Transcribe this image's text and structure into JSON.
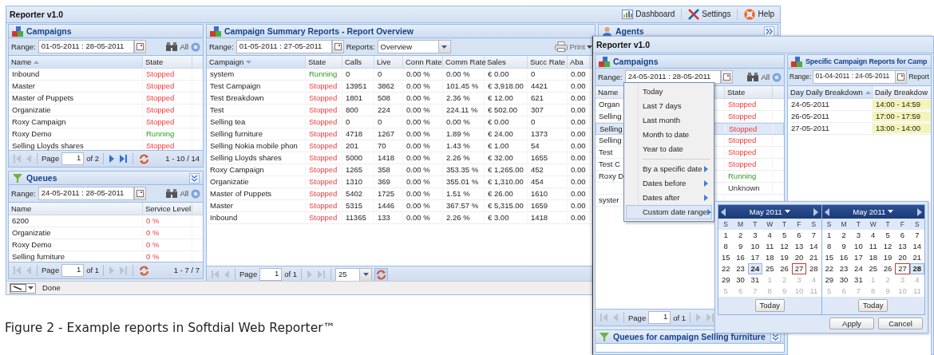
{
  "main_window": {
    "title": "Reporter v1.0",
    "toolbar": [
      {
        "label": "Dashboard"
      },
      {
        "label": "Settings"
      },
      {
        "label": "Help"
      }
    ],
    "campaigns": {
      "title": "Campaigns",
      "range_label": "Range:",
      "range": "01-05-2011 : 28-05-2011",
      "all_label": "All",
      "columns": [
        {
          "label": "Name",
          "sorted": true,
          "descending": false
        },
        {
          "label": "State",
          "sorted": false
        }
      ],
      "rows": [
        {
          "cells": [
            "Inbound",
            "Stopped"
          ],
          "kind": "stopped"
        },
        {
          "cells": [
            "Master",
            "Stopped"
          ],
          "kind": "stopped"
        },
        {
          "cells": [
            "Master of Puppets",
            "Stopped"
          ],
          "kind": "stopped"
        },
        {
          "cells": [
            "Organizatie",
            "Stopped"
          ],
          "kind": "stopped"
        },
        {
          "cells": [
            "Roxy Campaign",
            "Stopped"
          ],
          "kind": "stopped"
        },
        {
          "cells": [
            "Roxy Demo",
            "Running"
          ],
          "kind": "running"
        },
        {
          "cells": [
            "Selling Lloyds shares",
            "Stopped"
          ],
          "kind": "stopped"
        }
      ],
      "pager": {
        "label": "Page",
        "value": "1",
        "of": "of 2",
        "info": "1 - 10 / 14",
        "can_back": false,
        "can_forward": true
      }
    },
    "queues": {
      "title": "Queues",
      "range_label": "Range:",
      "range": "24-05-2011 : 28-05-2011",
      "all_label": "All",
      "columns": [
        {
          "label": "Name",
          "sorted": false
        },
        {
          "label": "Service Level",
          "sorted": false
        }
      ],
      "rows": [
        {
          "cells": [
            "6200",
            "0 %"
          ],
          "kind": "alert"
        },
        {
          "cells": [
            "Organizatie",
            "0 %"
          ],
          "kind": "alert"
        },
        {
          "cells": [
            "Roxy Demo",
            "0 %"
          ],
          "kind": "alert"
        },
        {
          "cells": [
            "Selling furniture",
            "0 %"
          ],
          "kind": "alert"
        }
      ],
      "pager": {
        "label": "Page",
        "value": "1",
        "of": "of 1",
        "info": "1 - 7 / 7",
        "can_back": false,
        "can_forward": false
      }
    },
    "summary": {
      "title": "Campaign Summary Reports - Report Overview",
      "range_label": "Range:",
      "range": "01-05-2011 : 27-05-2011",
      "reports_label": "Reports:",
      "report": "Overview",
      "print_label": "Print",
      "columns": [
        {
          "label": "Campaign",
          "sorted": true,
          "descending": true
        },
        {
          "label": "State",
          "sorted": false
        },
        {
          "label": "Calls",
          "sorted": false
        },
        {
          "label": "Live",
          "sorted": false
        },
        {
          "label": "Conn Rate",
          "sorted": false
        },
        {
          "label": "Comm Rate",
          "sorted": false
        },
        {
          "label": "Sales",
          "sorted": false
        },
        {
          "label": "Succ Rate",
          "sorted": false
        },
        {
          "label": "Aba",
          "sorted": false
        }
      ],
      "rows": [
        {
          "cells": [
            "system",
            "Running",
            "0",
            "0",
            "0.00 %",
            "0.00 %",
            "€ 0.00",
            "0",
            "0.00"
          ],
          "kind": "running"
        },
        {
          "cells": [
            "Test Campaign",
            "Stopped",
            "13951",
            "3862",
            "0.00 %",
            "101.45 %",
            "€ 3,918.00",
            "4421",
            "0.00"
          ],
          "kind": "stopped"
        },
        {
          "cells": [
            "Test Breakdown",
            "Stopped",
            "1801",
            "508",
            "0.00 %",
            "2.36 %",
            "€ 12.00",
            "621",
            "0.00"
          ],
          "kind": "stopped"
        },
        {
          "cells": [
            "Test",
            "Stopped",
            "800",
            "224",
            "0.00 %",
            "224.11 %",
            "€ 502.00",
            "307",
            "0.00"
          ],
          "kind": "stopped"
        },
        {
          "cells": [
            "Selling tea",
            "Stopped",
            "0",
            "0",
            "0.00 %",
            "0.00 %",
            "€ 0.00",
            "0",
            "0.00"
          ],
          "kind": "stopped"
        },
        {
          "cells": [
            "Selling furniture",
            "Stopped",
            "4718",
            "1267",
            "0.00 %",
            "1.89 %",
            "€ 24.00",
            "1373",
            "0.00"
          ],
          "kind": "stopped"
        },
        {
          "cells": [
            "Selling Nokia mobile phon",
            "Stopped",
            "201",
            "70",
            "0.00 %",
            "1.43 %",
            "€ 1.00",
            "54",
            "0.00"
          ],
          "kind": "stopped"
        },
        {
          "cells": [
            "Selling Lloyds shares",
            "Stopped",
            "5000",
            "1418",
            "0.00 %",
            "2.26 %",
            "€ 32.00",
            "1655",
            "0.00"
          ],
          "kind": "stopped"
        },
        {
          "cells": [
            "Roxy Campaign",
            "Stopped",
            "1265",
            "358",
            "0.00 %",
            "353.35 %",
            "€ 1,265.00",
            "452",
            "0.00"
          ],
          "kind": "stopped"
        },
        {
          "cells": [
            "Organizatie",
            "Stopped",
            "1310",
            "369",
            "0.00 %",
            "355.01 %",
            "€ 1,310.00",
            "454",
            "0.00"
          ],
          "kind": "stopped"
        },
        {
          "cells": [
            "Master of Puppets",
            "Stopped",
            "5402",
            "1725",
            "0.00 %",
            "1.51 %",
            "€ 26.00",
            "1610",
            "0.00"
          ],
          "kind": "stopped"
        },
        {
          "cells": [
            "Master",
            "Stopped",
            "5315",
            "1446",
            "0.00 %",
            "367.57 %",
            "€ 5,315.00",
            "1659",
            "0.00"
          ],
          "kind": "stopped"
        },
        {
          "cells": [
            "Inbound",
            "Stopped",
            "11365",
            "133",
            "0.00 %",
            "2.26 %",
            "€ 3.00",
            "1418",
            "0.00"
          ],
          "kind": "stopped"
        }
      ],
      "pager": {
        "label": "Page",
        "value": "1",
        "of": "of 1",
        "page_size": "25",
        "can_back": false,
        "can_forward": false
      }
    },
    "agents": {
      "title": "Agents"
    },
    "status": "Done"
  },
  "second_window": {
    "title": "Reporter v1.0",
    "campaigns": {
      "title": "Campaigns",
      "range_label": "Range:",
      "range": "24-05-2011 : 28-05-2011",
      "all_label": "All",
      "columns": [
        {
          "label": "Name",
          "sorted": false
        },
        {
          "label": "State",
          "sorted": false
        }
      ],
      "rows": [
        {
          "cells": [
            "Organ",
            "Stopped"
          ],
          "kind": "stopped",
          "selected": false
        },
        {
          "cells": [
            "Selling",
            "Stopped"
          ],
          "kind": "stopped",
          "selected": false
        },
        {
          "cells": [
            "Selling",
            "Stopped"
          ],
          "kind": "stopped",
          "selected": true
        },
        {
          "cells": [
            "Selling",
            "Stopped"
          ],
          "kind": "stopped",
          "selected": false
        },
        {
          "cells": [
            "Test",
            "Stopped"
          ],
          "kind": "stopped",
          "selected": false
        },
        {
          "cells": [
            "Test C",
            "Stopped"
          ],
          "kind": "stopped",
          "selected": false
        },
        {
          "cells": [
            "Roxy D",
            "Running"
          ],
          "kind": "running",
          "selected": false
        },
        {
          "cells": [
            null,
            "Unknown"
          ],
          "kind": "unknown",
          "selected": false
        },
        {
          "cells": [
            "syster"
          ],
          "selected": false
        }
      ],
      "pager": {
        "label": "Page",
        "value": "1",
        "of": "of 1",
        "can_back": false,
        "can_forward": false
      }
    },
    "specific": {
      "title": "Specific Campaign Reports for Camp",
      "range_label": "Range:",
      "range": "01-04-2011 : 24-05-2011",
      "reports_label": "Report",
      "columns": [
        {
          "label": "Day Daily Breakdown",
          "sorted": true,
          "descending": false
        },
        {
          "label": "Daily Breakdow",
          "sorted": false
        }
      ],
      "rows": [
        {
          "cells": [
            "24-05-2011",
            "14:00 - 14:59"
          ]
        },
        {
          "cells": [
            "26-05-2011",
            "17:00 - 17:59"
          ]
        },
        {
          "cells": [
            "27-05-2011",
            "13:00 - 14:00"
          ]
        }
      ]
    },
    "queues_title": "Queues for campaign Selling furniture",
    "range_menu": [
      {
        "kind": "item",
        "label": "Today",
        "submenu": false,
        "active": false
      },
      {
        "kind": "item",
        "label": "Last 7 days",
        "submenu": false,
        "active": false
      },
      {
        "kind": "item",
        "label": "Last month",
        "submenu": false,
        "active": false
      },
      {
        "kind": "item",
        "label": "Month to date",
        "submenu": false,
        "active": false
      },
      {
        "kind": "item",
        "label": "Year to date",
        "submenu": false,
        "active": false
      },
      {
        "kind": "separator"
      },
      {
        "kind": "item",
        "label": "By a specific date",
        "submenu": true,
        "active": false
      },
      {
        "kind": "item",
        "label": "Dates before",
        "submenu": true,
        "active": false
      },
      {
        "kind": "item",
        "label": "Dates after",
        "submenu": true,
        "active": false
      },
      {
        "kind": "item",
        "label": "Custom date range",
        "submenu": true,
        "active": true
      }
    ],
    "date_picker": {
      "calendars": [
        {
          "month": "May 2011",
          "weekdays": [
            "S",
            "M",
            "T",
            "W",
            "T",
            "F",
            "S"
          ],
          "today_label": "Today",
          "weeks": [
            [
              {
                "day": "1",
                "in_month": true,
                "selected": false,
                "today": false
              },
              {
                "day": "2",
                "in_month": true,
                "selected": false,
                "today": false
              },
              {
                "day": "3",
                "in_month": true,
                "selected": false,
                "today": false
              },
              {
                "day": "4",
                "in_month": true,
                "selected": false,
                "today": false
              },
              {
                "day": "5",
                "in_month": true,
                "selected": false,
                "today": false
              },
              {
                "day": "6",
                "in_month": true,
                "selected": false,
                "today": false
              },
              {
                "day": "7",
                "in_month": true,
                "selected": false,
                "today": false
              }
            ],
            [
              {
                "day": "8",
                "in_month": true,
                "selected": false,
                "today": false
              },
              {
                "day": "9",
                "in_month": true,
                "selected": false,
                "today": false
              },
              {
                "day": "10",
                "in_month": true,
                "selected": false,
                "today": false
              },
              {
                "day": "11",
                "in_month": true,
                "selected": false,
                "today": false
              },
              {
                "day": "12",
                "in_month": true,
                "selected": false,
                "today": false
              },
              {
                "day": "13",
                "in_month": true,
                "selected": false,
                "today": false
              },
              {
                "day": "14",
                "in_month": true,
                "selected": false,
                "today": false
              }
            ],
            [
              {
                "day": "15",
                "in_month": true,
                "selected": false,
                "today": false
              },
              {
                "day": "16",
                "in_month": true,
                "selected": false,
                "today": false
              },
              {
                "day": "17",
                "in_month": true,
                "selected": false,
                "today": false
              },
              {
                "day": "18",
                "in_month": true,
                "selected": false,
                "today": false
              },
              {
                "day": "19",
                "in_month": true,
                "selected": false,
                "today": false
              },
              {
                "day": "20",
                "in_month": true,
                "selected": false,
                "today": false
              },
              {
                "day": "21",
                "in_month": true,
                "selected": false,
                "today": false
              }
            ],
            [
              {
                "day": "22",
                "in_month": true,
                "selected": false,
                "today": false
              },
              {
                "day": "23",
                "in_month": true,
                "selected": false,
                "today": false
              },
              {
                "day": "24",
                "in_month": true,
                "selected": true,
                "today": false
              },
              {
                "day": "25",
                "in_month": true,
                "selected": false,
                "today": false
              },
              {
                "day": "26",
                "in_month": true,
                "selected": false,
                "today": false
              },
              {
                "day": "27",
                "in_month": true,
                "selected": false,
                "today": true
              },
              {
                "day": "28",
                "in_month": true,
                "selected": false,
                "today": false
              }
            ],
            [
              {
                "day": "29",
                "in_month": true,
                "selected": false,
                "today": false
              },
              {
                "day": "30",
                "in_month": true,
                "selected": false,
                "today": false
              },
              {
                "day": "31",
                "in_month": true,
                "selected": false,
                "today": false
              },
              {
                "day": "1",
                "in_month": false,
                "selected": false,
                "today": false
              },
              {
                "day": "2",
                "in_month": false,
                "selected": false,
                "today": false
              },
              {
                "day": "3",
                "in_month": false,
                "selected": false,
                "today": false
              },
              {
                "day": "4",
                "in_month": false,
                "selected": false,
                "today": false
              }
            ],
            [
              {
                "day": "5",
                "in_month": false,
                "selected": false,
                "today": false
              },
              {
                "day": "6",
                "in_month": false,
                "selected": false,
                "today": false
              },
              {
                "day": "7",
                "in_month": false,
                "selected": false,
                "today": false
              },
              {
                "day": "8",
                "in_month": false,
                "selected": false,
                "today": false
              },
              {
                "day": "9",
                "in_month": false,
                "selected": false,
                "today": false
              },
              {
                "day": "10",
                "in_month": false,
                "selected": false,
                "today": false
              },
              {
                "day": "11",
                "in_month": false,
                "selected": false,
                "today": false
              }
            ]
          ]
        },
        {
          "month": "May 2011",
          "weekdays": [
            "S",
            "M",
            "T",
            "W",
            "T",
            "F",
            "S"
          ],
          "today_label": "Today",
          "weeks": [
            [
              {
                "day": "1",
                "in_month": true,
                "selected": false,
                "today": false
              },
              {
                "day": "2",
                "in_month": true,
                "selected": false,
                "today": false
              },
              {
                "day": "3",
                "in_month": true,
                "selected": false,
                "today": false
              },
              {
                "day": "4",
                "in_month": true,
                "selected": false,
                "today": false
              },
              {
                "day": "5",
                "in_month": true,
                "selected": false,
                "today": false
              },
              {
                "day": "6",
                "in_month": true,
                "selected": false,
                "today": false
              },
              {
                "day": "7",
                "in_month": true,
                "selected": false,
                "today": false
              }
            ],
            [
              {
                "day": "8",
                "in_month": true,
                "selected": false,
                "today": false
              },
              {
                "day": "9",
                "in_month": true,
                "selected": false,
                "today": false
              },
              {
                "day": "10",
                "in_month": true,
                "selected": false,
                "today": false
              },
              {
                "day": "11",
                "in_month": true,
                "selected": false,
                "today": false
              },
              {
                "day": "12",
                "in_month": true,
                "selected": false,
                "today": false
              },
              {
                "day": "13",
                "in_month": true,
                "selected": false,
                "today": false
              },
              {
                "day": "14",
                "in_month": true,
                "selected": false,
                "today": false
              }
            ],
            [
              {
                "day": "15",
                "in_month": true,
                "selected": false,
                "today": false
              },
              {
                "day": "16",
                "in_month": true,
                "selected": false,
                "today": false
              },
              {
                "day": "17",
                "in_month": true,
                "selected": false,
                "today": false
              },
              {
                "day": "18",
                "in_month": true,
                "selected": false,
                "today": false
              },
              {
                "day": "19",
                "in_month": true,
                "selected": false,
                "today": false
              },
              {
                "day": "20",
                "in_month": true,
                "selected": false,
                "today": false
              },
              {
                "day": "21",
                "in_month": true,
                "selected": false,
                "today": false
              }
            ],
            [
              {
                "day": "22",
                "in_month": true,
                "selected": false,
                "today": false
              },
              {
                "day": "23",
                "in_month": true,
                "selected": false,
                "today": false
              },
              {
                "day": "24",
                "in_month": true,
                "selected": false,
                "today": false
              },
              {
                "day": "25",
                "in_month": true,
                "selected": false,
                "today": false
              },
              {
                "day": "26",
                "in_month": true,
                "selected": false,
                "today": false
              },
              {
                "day": "27",
                "in_month": true,
                "selected": false,
                "today": true
              },
              {
                "day": "28",
                "in_month": true,
                "selected": true,
                "today": false
              }
            ],
            [
              {
                "day": "29",
                "in_month": true,
                "selected": false,
                "today": false
              },
              {
                "day": "30",
                "in_month": true,
                "selected": false,
                "today": false
              },
              {
                "day": "31",
                "in_month": true,
                "selected": false,
                "today": false
              },
              {
                "day": "1",
                "in_month": false,
                "selected": false,
                "today": false
              },
              {
                "day": "2",
                "in_month": false,
                "selected": false,
                "today": false
              },
              {
                "day": "3",
                "in_month": false,
                "selected": false,
                "today": false
              },
              {
                "day": "4",
                "in_month": false,
                "selected": false,
                "today": false
              }
            ],
            [
              {
                "day": "5",
                "in_month": false,
                "selected": false,
                "today": false
              },
              {
                "day": "6",
                "in_month": false,
                "selected": false,
                "today": false
              },
              {
                "day": "7",
                "in_month": false,
                "selected": false,
                "today": false
              },
              {
                "day": "8",
                "in_month": false,
                "selected": false,
                "today": false
              },
              {
                "day": "9",
                "in_month": false,
                "selected": false,
                "today": false
              },
              {
                "day": "10",
                "in_month": false,
                "selected": false,
                "today": false
              },
              {
                "day": "11",
                "in_month": false,
                "selected": false,
                "today": false
              }
            ]
          ]
        }
      ],
      "buttons": [
        "Apply",
        "Cancel"
      ]
    }
  },
  "caption": "Figure 2 - Example reports in Softdial Web Reporter™"
}
